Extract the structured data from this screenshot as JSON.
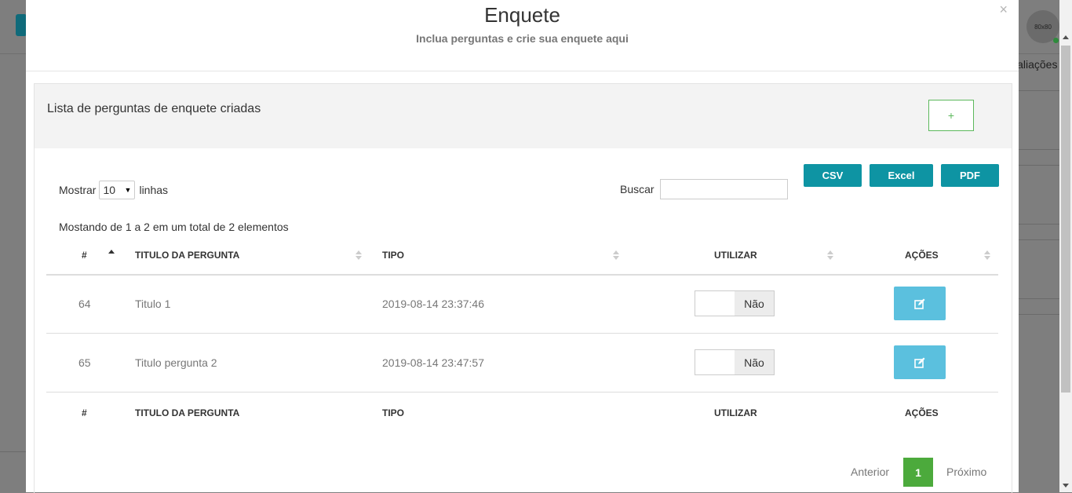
{
  "background": {
    "avatar_text": "80x80",
    "tab_label": "Avaliações"
  },
  "modal": {
    "title": "Enquete",
    "subtitle": "Inclua perguntas e crie sua enquete aqui",
    "close_label": "×"
  },
  "panel": {
    "title": "Lista de perguntas de enquete criadas",
    "add_label": "+"
  },
  "export_buttons": [
    "CSV",
    "Excel",
    "PDF"
  ],
  "length": {
    "prefix": "Mostrar",
    "value": "10",
    "suffix": "linhas"
  },
  "search": {
    "label": "Buscar",
    "value": ""
  },
  "info": "Mostando de 1 a 2 em um total de 2 elementos",
  "table": {
    "headers": [
      "#",
      "TITULO DA PERGUNTA",
      "TIPO",
      "UTILIZAR",
      "AÇÕES"
    ],
    "rows": [
      {
        "id": "64",
        "title": "Titulo 1",
        "tipo": "2019-08-14 23:37:46",
        "utilizar": "Não"
      },
      {
        "id": "65",
        "title": "Titulo pergunta 2",
        "tipo": "2019-08-14 23:47:57",
        "utilizar": "Não"
      }
    ]
  },
  "pagination": {
    "prev": "Anterior",
    "current": "1",
    "next": "Próximo"
  },
  "colors": {
    "export": "#0e94a3",
    "edit": "#5bc0de",
    "add_border": "#5cb85c",
    "page_active": "#4caa3c"
  },
  "icons": {
    "edit": "pencil-square-icon",
    "close": "close-icon",
    "length_caret": "caret-down-icon"
  }
}
